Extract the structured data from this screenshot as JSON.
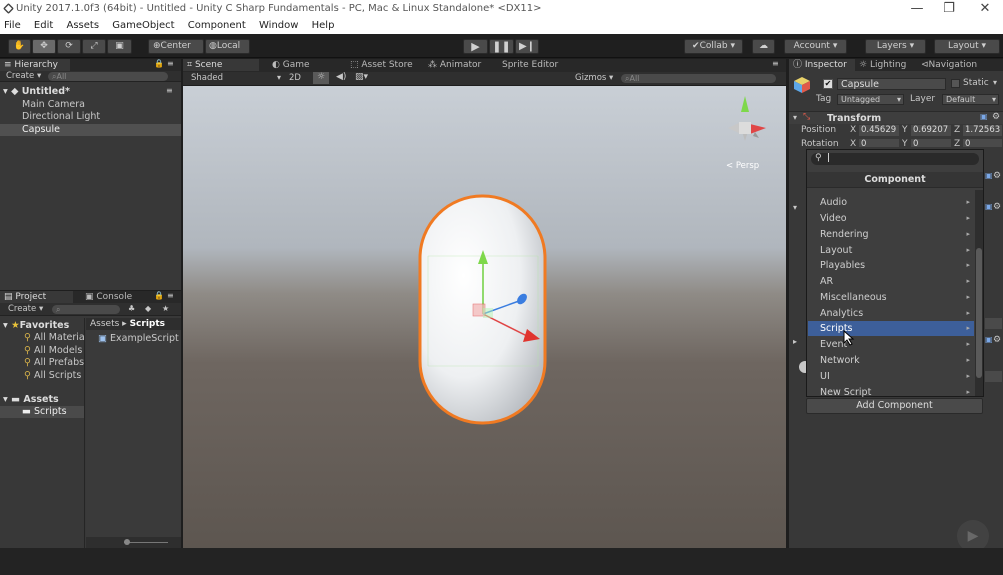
{
  "window": {
    "title": "Unity 2017.1.0f3 (64bit) - Untitled - Unity C Sharp Fundamentals - PC, Mac & Linux Standalone* <DX11>",
    "controls": [
      "—",
      "❐",
      "✕"
    ]
  },
  "menu": [
    "File",
    "Edit",
    "Assets",
    "GameObject",
    "Component",
    "Window",
    "Help"
  ],
  "toolbar": {
    "center": "Center",
    "local": "Local",
    "collab": "Collab ▾",
    "account": "Account",
    "layers": "Layers",
    "layout": "Layout"
  },
  "hierarchy": {
    "tab": "Hierarchy",
    "create": "Create ▾",
    "search": "All",
    "scene": "Untitled*",
    "items": [
      "Main Camera",
      "Directional Light",
      "Capsule"
    ]
  },
  "scene_tabs": {
    "scene": "Scene",
    "game": "Game",
    "asset_store": "Asset Store",
    "animator": "Animator",
    "sprite_editor": "Sprite Editor",
    "shaded": "Shaded",
    "mode2d": "2D",
    "gizmos": "Gizmos",
    "search": "All",
    "persp": "< Persp"
  },
  "project": {
    "tab_project": "Project",
    "tab_console": "Console",
    "create": "Create ▾",
    "favorites": "Favorites",
    "favorites_items": [
      "All Materia",
      "All Models",
      "All Prefabs",
      "All Scripts"
    ],
    "assets": "Assets",
    "assets_items": [
      "Scripts"
    ],
    "breadcrumb_root": "Assets",
    "breadcrumb_sep": "▸",
    "breadcrumb_leaf": "Scripts",
    "files": [
      "ExampleScript"
    ]
  },
  "inspector": {
    "tab_inspector": "Inspector",
    "tab_lighting": "Lighting",
    "tab_navigation": "Navigation",
    "object_name": "Capsule",
    "static": "Static",
    "tag_label": "Tag",
    "tag_value": "Untagged",
    "layer_label": "Layer",
    "layer_value": "Default",
    "transform": "Transform",
    "position_label": "Position",
    "rotation_label": "Rotation",
    "pos_x": "0.45629",
    "pos_y": "0.69207",
    "pos_z": "1.72563",
    "rot_x": "0",
    "rot_y": "0",
    "rot_z": "0",
    "x_label": "X",
    "y_label": "Y",
    "z_label": "Z",
    "add_component": "Add Component"
  },
  "component_popup": {
    "search_value": "",
    "header": "Component",
    "items": [
      "Audio",
      "Video",
      "Rendering",
      "Layout",
      "Playables",
      "AR",
      "Miscellaneous",
      "Analytics",
      "Scripts",
      "Event",
      "Network",
      "UI",
      "New Script"
    ],
    "highlighted": "Scripts"
  },
  "colors": {
    "highlight": "#3d5f9a",
    "selection_outline": "#f07a22"
  }
}
